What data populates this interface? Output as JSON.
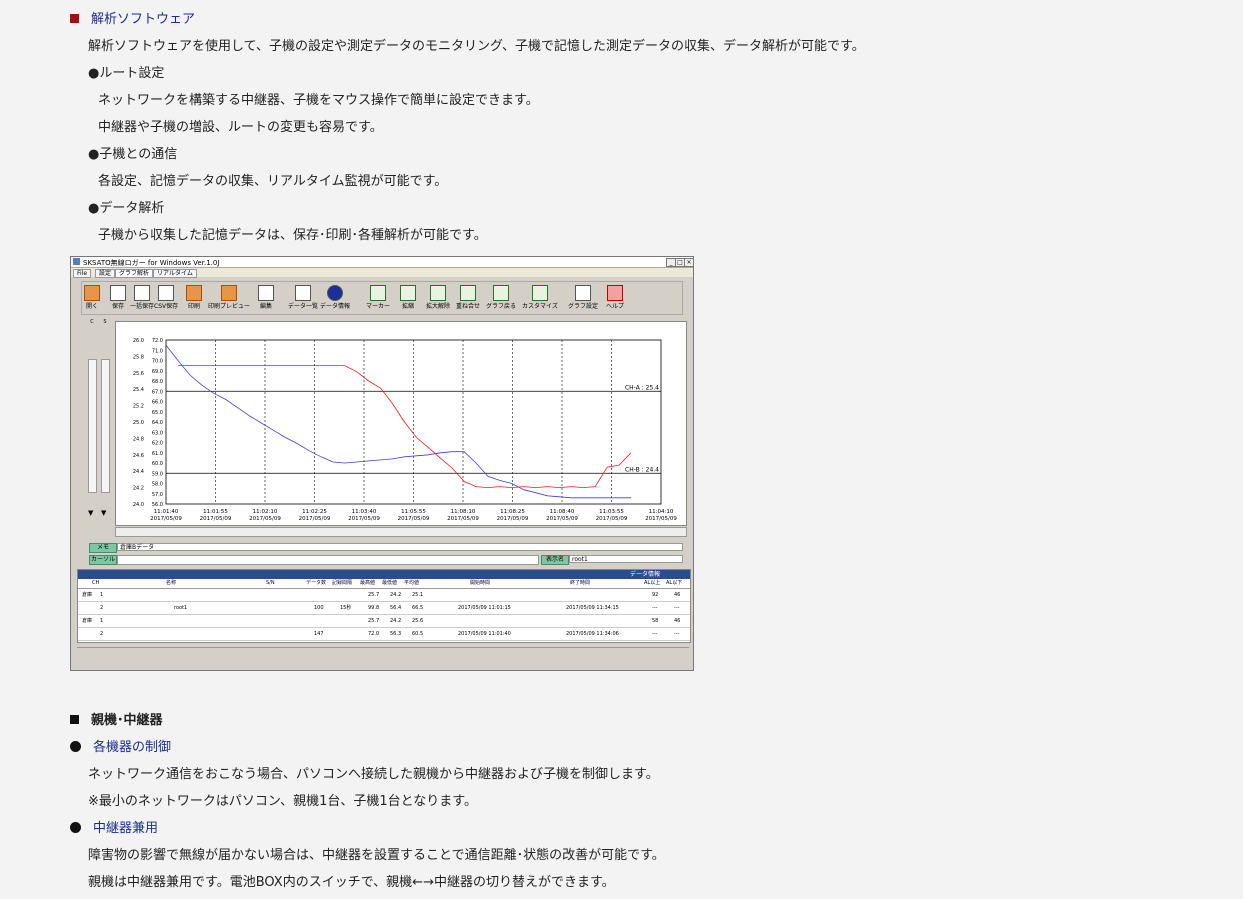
{
  "section1": {
    "title": "解析ソフトウェア",
    "intro": "解析ソフトウェアを使用して、子機の設定や測定データのモニタリング、子機で記憶した測定データの収集、データ解析が可能です。",
    "items": [
      {
        "heading": "●ルート設定",
        "lines": [
          "ネットワークを構築する中継器、子機をマウス操作で簡単に設定できます。",
          "中継器や子機の増設、ルートの変更も容易です。"
        ]
      },
      {
        "heading": "●子機との通信",
        "lines": [
          "各設定、記憶データの収集、リアルタイム監視が可能です。"
        ]
      },
      {
        "heading": "●データ解析",
        "lines": [
          "子機から収集した記憶データは、保存･印刷･各種解析が可能です。"
        ]
      }
    ],
    "accent_color": "#a01010"
  },
  "screenshot": {
    "window_title": "SKSATO無線ロガー for Windows Ver.1.0J",
    "tabs": [
      "File",
      "設定",
      "グラフ解析",
      "リアルタイム"
    ],
    "toolbar": [
      "開く",
      "保存",
      "一括保存",
      "CSV保存",
      "印刷",
      "印刷プレビュー",
      "編集",
      "データ一覧",
      "データ情報",
      "マーカー",
      "拡縮",
      "拡大解除",
      "重ね合せ",
      "グラフ戻る",
      "カスタマイズ",
      "グラフ設定",
      "ヘルプ"
    ],
    "memo_label": "メモ",
    "memo_value": "倉庫Bデータ",
    "cursor_label": "カーソル",
    "display_label": "表示名",
    "display_value": "root1",
    "info_title": "データ情報",
    "table_headers": [
      "CH",
      "名称",
      "S/N",
      "データ数",
      "記録間隔",
      "最高値",
      "最低値",
      "平均値",
      "開始時間",
      "終了時間",
      "AL以上",
      "AL以下"
    ],
    "rows": [
      {
        "group": "倉庫",
        "name": "root1",
        "ch": [
          "1",
          "2"
        ],
        "count": "100",
        "interval": "15秒",
        "max": [
          "25.7",
          "99.8"
        ],
        "min": [
          "24.2",
          "56.4"
        ],
        "avg": [
          "25.1",
          "66.5"
        ],
        "start": "2017/05/09 11:01:15",
        "end": "2017/05/09 11:34:15",
        "al_hi": [
          "92",
          "---"
        ],
        "al_lo": [
          "46",
          "---"
        ]
      },
      {
        "group": "倉庫",
        "name": "",
        "ch": [
          "1",
          "2"
        ],
        "count": "147",
        "interval": "",
        "max": [
          "25.7",
          "72.0"
        ],
        "min": [
          "24.2",
          "56.3"
        ],
        "avg": [
          "25.6",
          "60.5"
        ],
        "start": "2017/05/09 11:01:40",
        "end": "2017/05/09 11:34:06",
        "al_hi": [
          "58",
          "---"
        ],
        "al_lo": [
          "46",
          "---"
        ]
      }
    ]
  },
  "chart_data": {
    "type": "line",
    "x": [
      "11:01:40",
      "11:01:55",
      "11:02:10",
      "11:02:25",
      "11:03:40",
      "11:05:55",
      "11:08:10",
      "11:08:25",
      "11:08:40",
      "11:03:55",
      "11:04:10"
    ],
    "x_dates": [
      "2017/05/09",
      "2017/05/09",
      "2017/05/09",
      "2017/05/09",
      "2017/05/09",
      "2017/05/09",
      "2017/05/09",
      "2017/05/09",
      "2017/05/09",
      "2017/05/09",
      "2017/05/09"
    ],
    "y_left_ticks": [
      "26.0",
      "25.8",
      "25.6",
      "25.4",
      "25.2",
      "25.0",
      "24.8",
      "24.6",
      "24.4",
      "24.2",
      "24.0"
    ],
    "y_right_ticks": [
      "72.0",
      "71.0",
      "70.0",
      "69.0",
      "68.0",
      "67.0",
      "66.0",
      "65.0",
      "64.0",
      "63.0",
      "62.0",
      "61.0",
      "60.0",
      "59.0",
      "58.0",
      "57.0",
      "56.0"
    ],
    "ylim": [
      56.0,
      72.0
    ],
    "annotations": [
      "CH-A : 25.4",
      "CH-B : 24.4"
    ],
    "threshold_values": [
      67.0,
      59.0
    ],
    "grid": true,
    "series": [
      {
        "color": "#4040d0",
        "values": [
          71.5,
          70.0,
          68.6,
          67.6,
          66.8,
          66.2,
          65.4,
          64.6,
          63.9,
          63.2,
          62.5,
          61.9,
          61.2,
          60.6,
          60.1,
          60.0,
          60.1,
          60.2,
          60.3,
          60.4,
          60.6,
          60.7,
          60.8,
          61.0,
          61.1,
          61.1,
          60.0,
          58.7,
          58.3,
          58.0,
          57.4,
          57.1,
          56.8,
          56.7,
          56.6,
          56.6,
          56.6,
          56.6,
          56.6,
          56.6
        ]
      },
      {
        "color": "#e02020",
        "values": [
          null,
          69.5,
          69.5,
          69.5,
          69.5,
          69.5,
          69.5,
          69.5,
          69.5,
          69.5,
          69.5,
          69.5,
          69.5,
          69.5,
          69.5,
          69.5,
          68.9,
          68.0,
          67.3,
          65.8,
          64.0,
          62.5,
          61.5,
          60.5,
          59.5,
          58.2,
          57.7,
          57.6,
          57.7,
          57.6,
          57.7,
          57.6,
          57.7,
          57.6,
          57.7,
          57.6,
          57.7,
          59.6,
          59.8,
          61.0
        ]
      }
    ]
  },
  "section2": {
    "title": "親機･中継器",
    "accent_color": "#111111",
    "sub1_title": "各機器の制御",
    "sub1_lines": [
      "ネットワーク通信をおこなう場合、パソコンへ接続した親機から中継器および子機を制御します。",
      "※最小のネットワークはパソコン、親機1台、子機1台となります。"
    ],
    "sub2_title": "中継器兼用",
    "sub2_lines": [
      "障害物の影響で無線が届かない場合は、中継器を設置することで通信距離･状態の改善が可能です。",
      "親機は中継器兼用です。電池BOX内のスイッチで、親機←→中継器の切り替えができます。"
    ]
  }
}
